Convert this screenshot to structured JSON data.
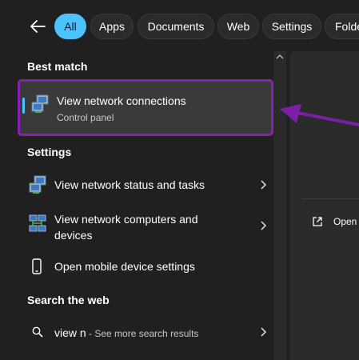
{
  "filters": {
    "back_icon": "back-arrow-icon",
    "tabs": [
      {
        "label": "All",
        "active": true
      },
      {
        "label": "Apps",
        "active": false
      },
      {
        "label": "Documents",
        "active": false
      },
      {
        "label": "Web",
        "active": false
      },
      {
        "label": "Settings",
        "active": false
      },
      {
        "label": "Folde",
        "active": false
      }
    ]
  },
  "best_match": {
    "header": "Best match",
    "item": {
      "title": "View network connections",
      "subtitle": "Control panel",
      "icon": "network-connections-icon"
    }
  },
  "settings": {
    "header": "Settings",
    "items": [
      {
        "title": "View network status and tasks",
        "icon": "network-status-icon"
      },
      {
        "title_line1": "View network computers and",
        "title_line2": "devices",
        "icon": "network-computers-icon"
      },
      {
        "title": "Open mobile device settings",
        "icon": "mobile-device-icon"
      }
    ]
  },
  "web": {
    "header": "Search the web",
    "item": {
      "query": "view n",
      "suffix": " - See more search results",
      "icon": "search-icon"
    }
  },
  "preview": {
    "open_label": "Open",
    "open_icon": "open-external-icon"
  },
  "colors": {
    "accent": "#4cc2ff",
    "highlight": "#8a1fb8",
    "background": "#202020"
  }
}
